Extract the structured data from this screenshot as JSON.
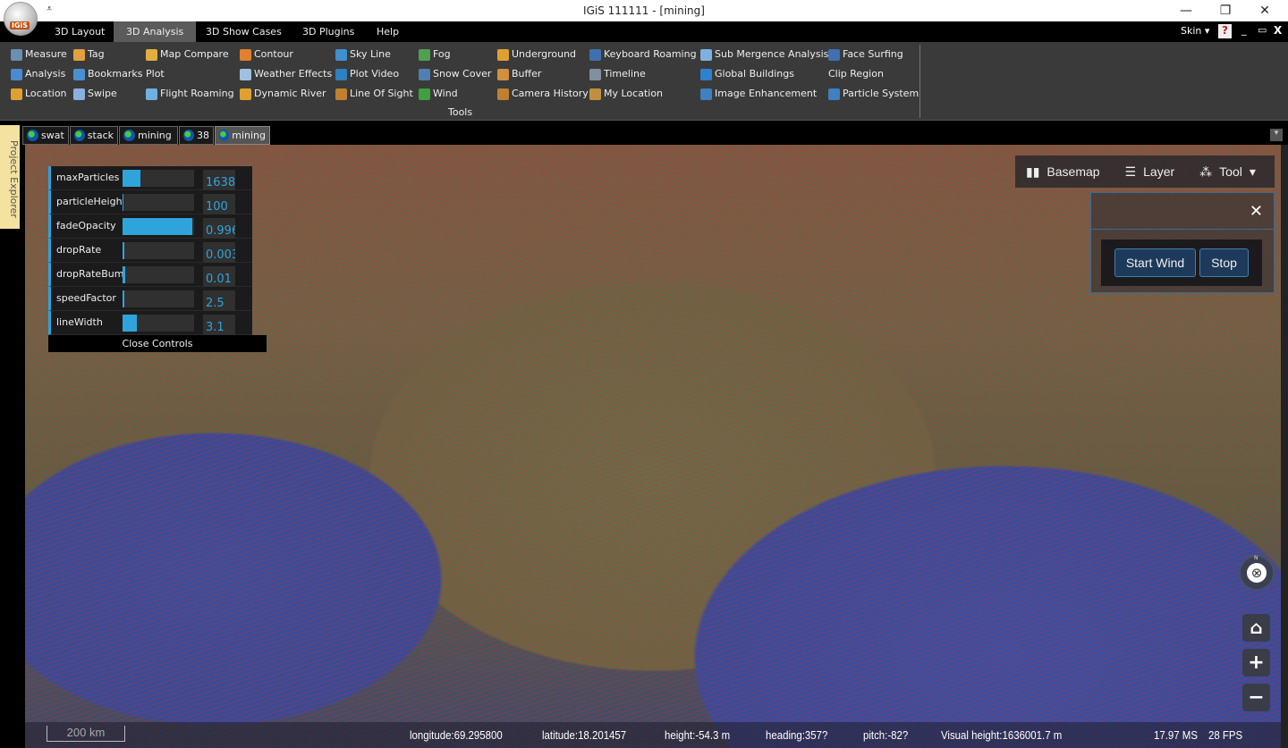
{
  "window": {
    "title": "IGiS 111111 - [mining]",
    "logo_text": "IGiS",
    "quick_access_icon": "customize-qat-icon"
  },
  "menu": {
    "tabs": [
      "3D Layout",
      "3D Analysis",
      "3D Show Cases",
      "3D Plugins",
      "Help"
    ],
    "active": "3D Analysis",
    "skin_label": "Skin"
  },
  "ribbon": {
    "group_label": "Tools",
    "items": [
      {
        "label": "Measure",
        "icon": "measure-icon",
        "color": "#6a8fb0"
      },
      {
        "label": "Analysis",
        "icon": "analysis-icon",
        "color": "#4a8ad0"
      },
      {
        "label": "Location",
        "icon": "location-pin-icon",
        "color": "#e0a030"
      },
      {
        "label": "Tag",
        "icon": "tag-icon",
        "color": "#e0a040"
      },
      {
        "label": "Bookmarks",
        "icon": "bookmark-icon",
        "color": "#4a90d0"
      },
      {
        "label": "Swipe",
        "icon": "swipe-icon",
        "color": "#8ab0e0"
      },
      {
        "label": "Map Compare",
        "icon": "map-compare-icon",
        "color": "#e0b040"
      },
      {
        "label": "Plot",
        "icon": "",
        "color": ""
      },
      {
        "label": "Flight Roaming",
        "icon": "airplane-icon",
        "color": "#70b0e0"
      },
      {
        "label": "Contour",
        "icon": "contour-icon",
        "color": "#e08030"
      },
      {
        "label": "Weather Effects",
        "icon": "weather-icon",
        "color": "#a0c0e0"
      },
      {
        "label": "Dynamic River",
        "icon": "river-icon",
        "color": "#e0a030"
      },
      {
        "label": "Sky Line",
        "icon": "sky-line-icon",
        "color": "#4090d0"
      },
      {
        "label": "Plot Video",
        "icon": "video-icon",
        "color": "#3080c0"
      },
      {
        "label": "Line Of Sight",
        "icon": "line-of-sight-icon",
        "color": "#c08030"
      },
      {
        "label": "Fog",
        "icon": "fog-icon",
        "color": "#50a050"
      },
      {
        "label": "Snow Cover",
        "icon": "snow-icon",
        "color": "#5080b0"
      },
      {
        "label": "Wind",
        "icon": "wind-icon",
        "color": "#40a040"
      },
      {
        "label": "Underground",
        "icon": "underground-icon",
        "color": "#e0a030"
      },
      {
        "label": "Buffer",
        "icon": "buffer-icon",
        "color": "#d09040"
      },
      {
        "label": "Camera History",
        "icon": "camera-history-icon",
        "color": "#c08030"
      },
      {
        "label": "Keyboard Roaming",
        "icon": "keyboard-icon",
        "color": "#4070b0"
      },
      {
        "label": "Timeline",
        "icon": "timeline-icon",
        "color": "#8090a0"
      },
      {
        "label": "My Location",
        "icon": "my-location-icon",
        "color": "#c09040"
      },
      {
        "label": "Sub Mergence Analysis",
        "icon": "submergence-icon",
        "color": "#80b0e0"
      },
      {
        "label": "Global Buildings",
        "icon": "buildings-icon",
        "color": "#3080d0"
      },
      {
        "label": "Image Enhancement",
        "icon": "image-enhance-icon",
        "color": "#4080c0"
      },
      {
        "label": "Face Surfing",
        "icon": "face-surfing-icon",
        "color": "#4070b0"
      },
      {
        "label": "Clip Region",
        "icon": "",
        "color": ""
      },
      {
        "label": "Particle System",
        "icon": "particle-icon",
        "color": "#4080c0"
      }
    ]
  },
  "side_panel": {
    "label": "Project Explorer"
  },
  "documents": [
    {
      "label": "swat"
    },
    {
      "label": "stack"
    },
    {
      "label": "mining"
    },
    {
      "label": "38"
    },
    {
      "label": "mining",
      "active": true
    }
  ],
  "controls": {
    "rows": [
      {
        "label": "maxParticles",
        "value": "1638",
        "fill": 0.25
      },
      {
        "label": "particleHeight",
        "value": "100",
        "fill": 0.01
      },
      {
        "label": "fadeOpacity",
        "value": "0.996",
        "fill": 0.98
      },
      {
        "label": "dropRate",
        "value": "0.003",
        "fill": 0.03
      },
      {
        "label": "dropRateBump",
        "value": "0.01",
        "fill": 0.04
      },
      {
        "label": "speedFactor",
        "value": "2.5",
        "fill": 0.02
      },
      {
        "label": "lineWidth",
        "value": "3.1",
        "fill": 0.2
      }
    ],
    "close_label": "Close Controls",
    "accent": "#2fa4dc"
  },
  "map_toolbar": {
    "basemap": "Basemap",
    "layer": "Layer",
    "tool": "Tool"
  },
  "wind_panel": {
    "start": "Start Wind",
    "stop": "Stop"
  },
  "status": {
    "scale": "200 km",
    "longitude": "longitude:69.295800",
    "latitude": "latitude:18.201457",
    "height": "height:-54.3 m",
    "heading": "heading:357?",
    "pitch": "pitch:-82?",
    "visual_height": "Visual height:1636001.7 m",
    "ms": "17.97 MS",
    "fps": "28 FPS"
  },
  "compass": {
    "north": "N"
  }
}
